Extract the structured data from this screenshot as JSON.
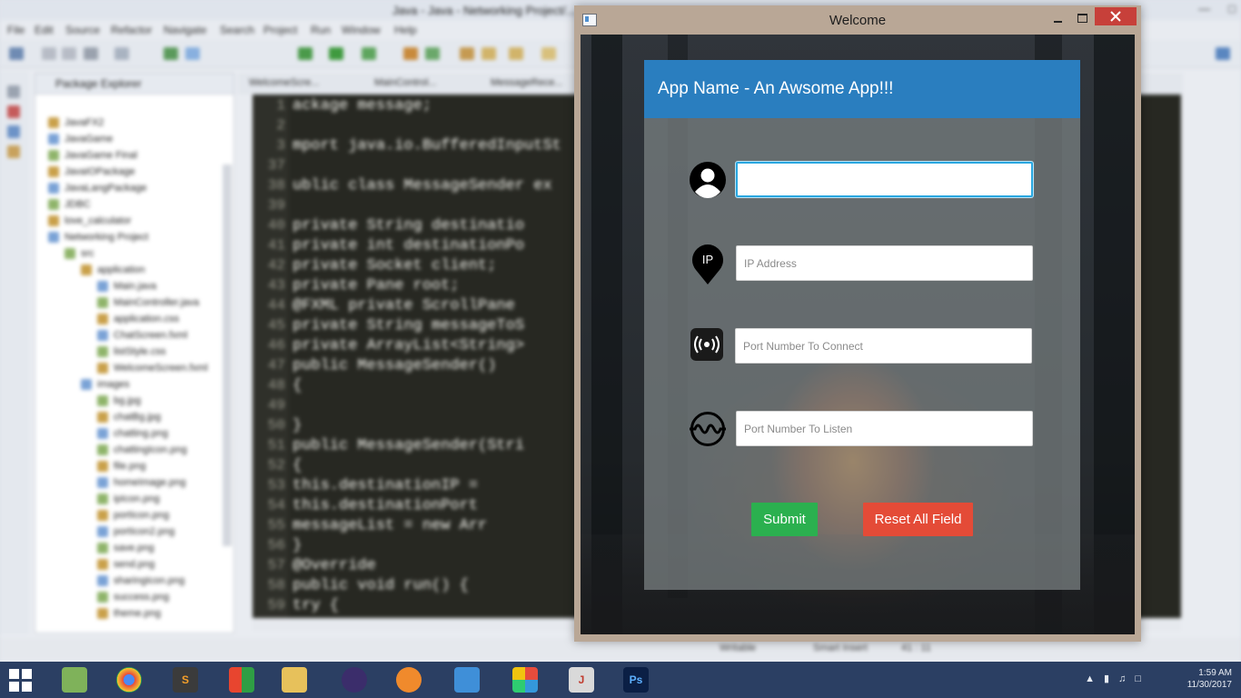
{
  "ide": {
    "title": "Java - Java - Networking Project/...",
    "menu": [
      "File",
      "Edit",
      "Source",
      "Refactor",
      "Navigate",
      "Search",
      "Project",
      "Run",
      "Window",
      "Help"
    ],
    "package_explorer": {
      "title": "Package Explorer",
      "items": [
        "JavaFX2",
        "JavaGame",
        "JavaGame Final",
        "JavaIOPackage",
        "JavaLangPackage",
        "JDBC",
        "love_calculator",
        "Networking Project",
        "src",
        "application",
        "Main.java",
        "MainController.java",
        "application.css",
        "ChatScreen.fxml",
        "listStyle.css",
        "WelcomeScreen.fxml",
        "images",
        "bg.jpg",
        "chatBg.jpg",
        "chatting.png",
        "chattingIcon.png",
        "file.png",
        "homeImage.png",
        "ipIcon.png",
        "portIcon.png",
        "portIcon2.png",
        "save.png",
        "send.png",
        "sharingIcon.png",
        "success.png",
        "theme.png"
      ]
    },
    "editor_tabs": [
      "WelcomeScre...",
      "MainControl...",
      "MessageRece..."
    ],
    "code_lines": [
      {
        "n": "1",
        "t": "ackage message;"
      },
      {
        "n": "2",
        "t": ""
      },
      {
        "n": "3",
        "t": "mport java.io.BufferedInputSt"
      },
      {
        "n": "37",
        "t": ""
      },
      {
        "n": "38",
        "t": "ublic class MessageSender ex"
      },
      {
        "n": "39",
        "t": ""
      },
      {
        "n": "40",
        "t": "    private String destinatio"
      },
      {
        "n": "41",
        "t": "    private int destinationPo"
      },
      {
        "n": "42",
        "t": "    private Socket client;"
      },
      {
        "n": "43",
        "t": "    private Pane root;"
      },
      {
        "n": "44",
        "t": "    @FXML private ScrollPane "
      },
      {
        "n": "45",
        "t": "    private String messageToS"
      },
      {
        "n": "46",
        "t": "    private ArrayList<String>"
      },
      {
        "n": "47",
        "t": "    public MessageSender()"
      },
      {
        "n": "48",
        "t": "    {"
      },
      {
        "n": "49",
        "t": ""
      },
      {
        "n": "50",
        "t": "    }"
      },
      {
        "n": "51",
        "t": "    public MessageSender(Stri"
      },
      {
        "n": "52",
        "t": "    {"
      },
      {
        "n": "53",
        "t": "        this.destinationIP = "
      },
      {
        "n": "54",
        "t": "        this.destinationPort "
      },
      {
        "n": "55",
        "t": "        messageList = new Arr"
      },
      {
        "n": "56",
        "t": "    }"
      },
      {
        "n": "57",
        "t": "    @Override"
      },
      {
        "n": "58",
        "t": "    public void run() {"
      },
      {
        "n": "59",
        "t": "        try {"
      }
    ],
    "status": {
      "writable": "Writable",
      "insert": "Smart Insert",
      "position": "41 : 11"
    }
  },
  "taskbar": {
    "time": "1:59 AM",
    "date": "11/30/2017"
  },
  "window": {
    "title": "Welcome",
    "app_name": "App Name - An Awsome App!!!",
    "fields": {
      "username": {
        "value": "",
        "placeholder": ""
      },
      "ip": {
        "value": "",
        "placeholder": "IP Address",
        "icon_text": "IP"
      },
      "port_connect": {
        "value": "",
        "placeholder": "Port Number To Connect"
      },
      "port_listen": {
        "value": "",
        "placeholder": "Port Number To Listen"
      }
    },
    "buttons": {
      "submit": "Submit",
      "reset": "Reset All Field"
    },
    "colors": {
      "header": "#2a7ebf",
      "submit": "#2bb04f",
      "reset": "#e44b37",
      "close": "#c7403a"
    }
  }
}
